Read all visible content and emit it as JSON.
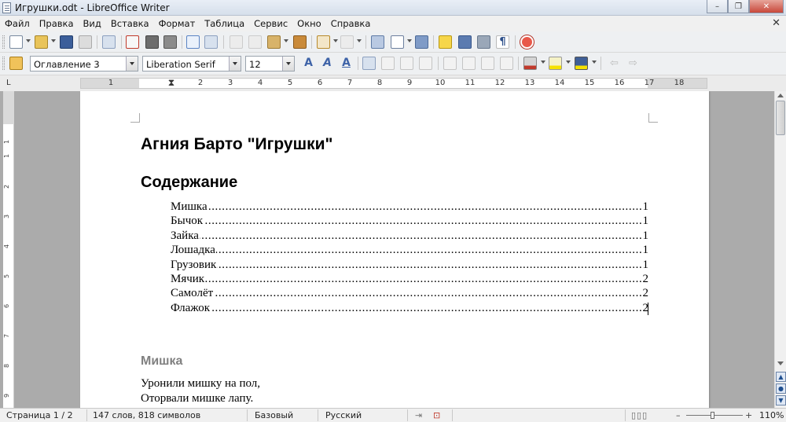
{
  "window": {
    "title": "Игрушки.odt - LibreOffice Writer",
    "minimize": "–",
    "maximize": "❐",
    "close": "✕"
  },
  "menu": {
    "items": [
      "Файл",
      "Правка",
      "Вид",
      "Вставка",
      "Формат",
      "Таблица",
      "Сервис",
      "Окно",
      "Справка"
    ],
    "close_doc": "✕"
  },
  "formatting": {
    "paragraph_style": "Оглавление 3",
    "font_name": "Liberation Serif",
    "font_size": "12"
  },
  "ruler": {
    "numbers": [
      "1",
      "1",
      "2",
      "3",
      "4",
      "5",
      "6",
      "7",
      "8",
      "9",
      "10",
      "11",
      "12",
      "13",
      "14",
      "15",
      "16",
      "17",
      "18"
    ],
    "vertical_numbers": [
      "1",
      "1",
      "2",
      "3",
      "4",
      "5",
      "6",
      "7",
      "8",
      "9"
    ]
  },
  "document": {
    "title": "Агния Барто \"Игрушки\"",
    "toc_heading": "Содержание",
    "toc": [
      {
        "title": "Мишка",
        "page": "1"
      },
      {
        "title": "Бычок",
        "page": "1"
      },
      {
        "title": "Зайка",
        "page": "1"
      },
      {
        "title": "Лошадка",
        "page": "1"
      },
      {
        "title": "Грузовик",
        "page": "1"
      },
      {
        "title": "Мячик",
        "page": "2"
      },
      {
        "title": "Самолёт",
        "page": "2"
      },
      {
        "title": "Флажок",
        "page": "2"
      }
    ],
    "toc_leader": "..............................................................................................................................................................................................................",
    "section_heading": "Мишка",
    "verse": [
      "Уронили мишку на пол,",
      "Оторвали мишке лапу."
    ]
  },
  "status": {
    "page": "Страница 1 / 2",
    "words": "147 слов, 818 символов",
    "style": "Базовый",
    "language": "Русский",
    "zoom": "110%"
  },
  "colors": {
    "heading_gray": "#808080",
    "toolbar_bg": "#eef0f2"
  }
}
